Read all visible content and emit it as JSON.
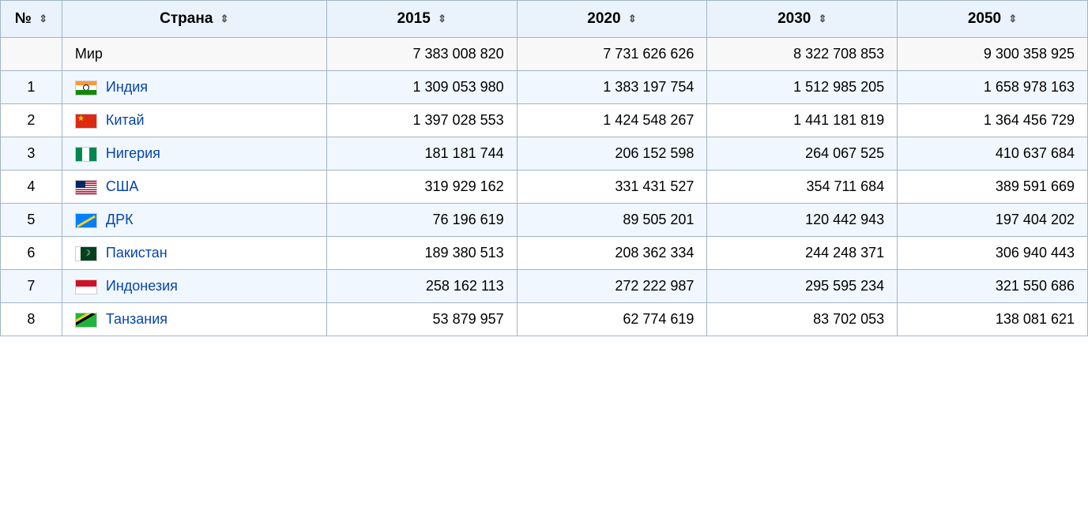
{
  "table": {
    "headers": [
      {
        "id": "num",
        "label": "№",
        "sortable": true
      },
      {
        "id": "country",
        "label": "Страна",
        "sortable": true
      },
      {
        "id": "y2015",
        "label": "2015",
        "sortable": true
      },
      {
        "id": "y2020",
        "label": "2020",
        "sortable": true
      },
      {
        "id": "y2030",
        "label": "2030",
        "sortable": true
      },
      {
        "id": "y2050",
        "label": "2050",
        "sortable": true
      }
    ],
    "world_row": {
      "num": "",
      "country": "Мир",
      "y2015": "7 383 008 820",
      "y2020": "7 731 626 626",
      "y2030": "8 322 708 853",
      "y2050": "9 300 358 925"
    },
    "rows": [
      {
        "num": "1",
        "country": "Индия",
        "flag": "india",
        "y2015": "1 309 053 980",
        "y2020": "1 383 197 754",
        "y2030": "1 512 985 205",
        "y2050": "1 658 978 163"
      },
      {
        "num": "2",
        "country": "Китай",
        "flag": "china",
        "y2015": "1 397 028 553",
        "y2020": "1 424 548 267",
        "y2030": "1 441 181 819",
        "y2050": "1 364 456 729"
      },
      {
        "num": "3",
        "country": "Нигерия",
        "flag": "nigeria",
        "y2015": "181 181 744",
        "y2020": "206 152 598",
        "y2030": "264 067 525",
        "y2050": "410 637 684"
      },
      {
        "num": "4",
        "country": "США",
        "flag": "usa",
        "y2015": "319 929 162",
        "y2020": "331 431 527",
        "y2030": "354 711 684",
        "y2050": "389 591 669"
      },
      {
        "num": "5",
        "country": "ДРК",
        "flag": "drc",
        "y2015": "76 196 619",
        "y2020": "89 505 201",
        "y2030": "120 442 943",
        "y2050": "197 404 202"
      },
      {
        "num": "6",
        "country": "Пакистан",
        "flag": "pakistan",
        "y2015": "189 380 513",
        "y2020": "208 362 334",
        "y2030": "244 248 371",
        "y2050": "306 940 443"
      },
      {
        "num": "7",
        "country": "Индонезия",
        "flag": "indonesia",
        "y2015": "258 162 113",
        "y2020": "272 222 987",
        "y2030": "295 595 234",
        "y2050": "321 550 686"
      },
      {
        "num": "8",
        "country": "Танзания",
        "flag": "tanzania",
        "y2015": "53 879 957",
        "y2020": "62 774 619",
        "y2030": "83 702 053",
        "y2050": "138 081 621"
      }
    ],
    "sort_symbol": "⇕"
  }
}
